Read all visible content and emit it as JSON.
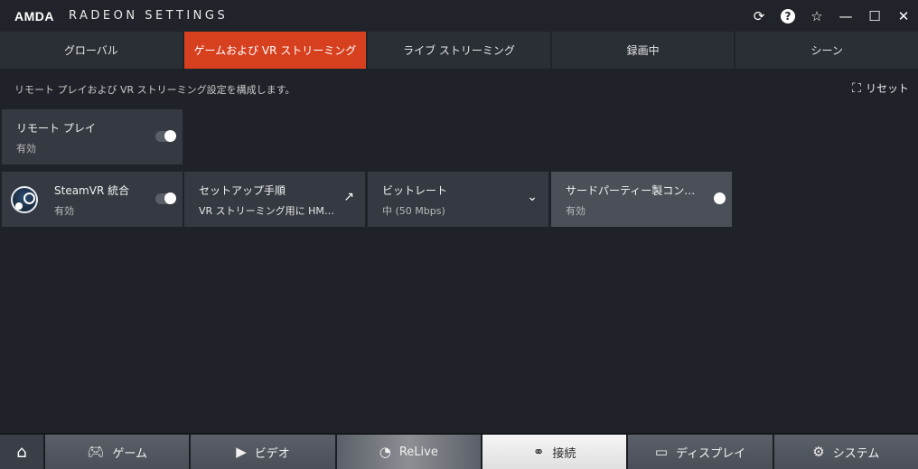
{
  "window": {
    "logo_text": "AMDA",
    "app_title": "RADEON SETTINGS",
    "icons": [
      "update-icon",
      "help-icon",
      "favorite-star-icon",
      "minimize-icon",
      "maximize-icon",
      "close-icon"
    ]
  },
  "tabs": [
    {
      "label": "グローバル",
      "active": false
    },
    {
      "label": "ゲームおよび VR ストリーミング",
      "active": true
    },
    {
      "label": "ライブ ストリーミング",
      "active": false
    },
    {
      "label": "録画中",
      "active": false
    },
    {
      "label": "シーン",
      "active": false
    }
  ],
  "description": "リモート プレイおよび VR ストリーミング設定を構成します。",
  "reset_label": "リセット",
  "cards": {
    "remote_play": {
      "label": "リモート プレイ",
      "value": "有効"
    },
    "steamvr": {
      "label": "SteamVR 統合",
      "value": "有効"
    },
    "setup": {
      "label": "セットアップ手順",
      "value": "VR ストリーミング用に HMD を…"
    },
    "bitrate": {
      "label": "ビットレート",
      "value": "中 (50 Mbps)"
    },
    "third_party": {
      "label": "サードパーティー製コントローラー…",
      "value": "有効"
    }
  },
  "bottom_nav": {
    "home_icon": "home-icon",
    "items": [
      {
        "label": "ゲーム",
        "icon": "gamepad-icon"
      },
      {
        "label": "ビデオ",
        "icon": "play-icon"
      },
      {
        "label": "ReLive",
        "icon": "relive-icon"
      },
      {
        "label": "接続",
        "icon": "connect-icon",
        "active": true
      },
      {
        "label": "ディスプレイ",
        "icon": "display-icon"
      },
      {
        "label": "システム",
        "icon": "system-gear-icon"
      }
    ]
  },
  "colors": {
    "accent": "#d7401f",
    "background": "#1f2329",
    "card": "#353a42"
  }
}
